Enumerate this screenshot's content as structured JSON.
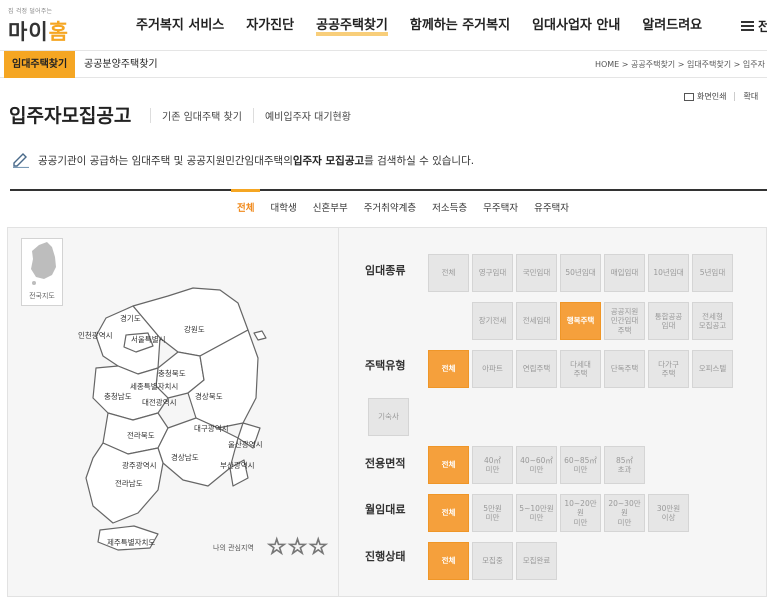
{
  "logo": {
    "tagline": "집 걱정 덜어주는",
    "brand_a": "마이",
    "brand_b": "홈"
  },
  "gnb": [
    "주거복지 서비스",
    "자가진단",
    "공공주택찾기",
    "함께하는 주거복지",
    "임대사업자 안내",
    "알려드려요"
  ],
  "gnb_active_index": 2,
  "menu_label": "전",
  "subnav": {
    "active": "임대주택찾기",
    "other": "공공분양주택찾기"
  },
  "breadcrumb": "HOME > 공공주택찾기 > 임대주택찾기 > 입주자",
  "util": {
    "print": "화면인쇄",
    "zoom": "확대"
  },
  "page_title": "입주자모집공고",
  "title_links": [
    "기존 임대주택 찾기",
    "예비입주자 대기현황"
  ],
  "description": {
    "pre": "공공기관이 공급하는 임대주택 및 공공지원민간임대주택의 ",
    "bold": "입주자 모집공고",
    "post": "를 검색하실 수 있습니다."
  },
  "tabs": [
    "전체",
    "대학생",
    "신혼부부",
    "주거취약계층",
    "저소득층",
    "무주택자",
    "유주택자"
  ],
  "tabs_active_index": 0,
  "map": {
    "whole_label": "전국지도",
    "regions": [
      "경기도",
      "인천광역시",
      "서울특별시",
      "강원도",
      "충청북도",
      "세종특별자치시",
      "충청남도",
      "대전광역시",
      "경상북도",
      "대구광역시",
      "울산광역시",
      "전라북도",
      "경상남도",
      "광주광역시",
      "부산광역시",
      "전라남도",
      "제주특별자치도"
    ],
    "favorites_label": "나의 관심지역"
  },
  "filters": {
    "rental_type": {
      "label": "임대종류",
      "options": [
        "전체",
        "영구임대",
        "국민임대",
        "50년임대",
        "매입임대",
        "10년임대",
        "5년임대",
        "장기전세",
        "전세임대",
        "행복주택",
        "공공지원\n민간임대\n주택",
        "통합공공\n임대",
        "전세형\n모집공고"
      ],
      "selected": "행복주택"
    },
    "housing_type": {
      "label": "주택유형",
      "options": [
        "전체",
        "아파트",
        "연립주택",
        "다세대\n주택",
        "단독주택",
        "다가구\n주택",
        "오피스텔",
        "기숙사"
      ],
      "selected": "전체"
    },
    "area": {
      "label": "전용면적",
      "options": [
        "전체",
        "40㎡\n미만",
        "40~60㎡\n미만",
        "60~85㎡\n미만",
        "85㎡\n초과"
      ],
      "selected": "전체"
    },
    "monthly_rent": {
      "label": "월임대료",
      "options": [
        "전체",
        "5만원\n미만",
        "5~10만원\n미만",
        "10~20만원\n미만",
        "20~30만원\n미만",
        "30만원\n이상"
      ],
      "selected": "전체"
    },
    "status": {
      "label": "진행상태",
      "options": [
        "전체",
        "모집중",
        "모집완료"
      ],
      "selected": "전체"
    }
  },
  "colors": {
    "accent": "#f5a623",
    "selected_btn": "#f5a03c",
    "tab_active": "#f08a1c"
  }
}
